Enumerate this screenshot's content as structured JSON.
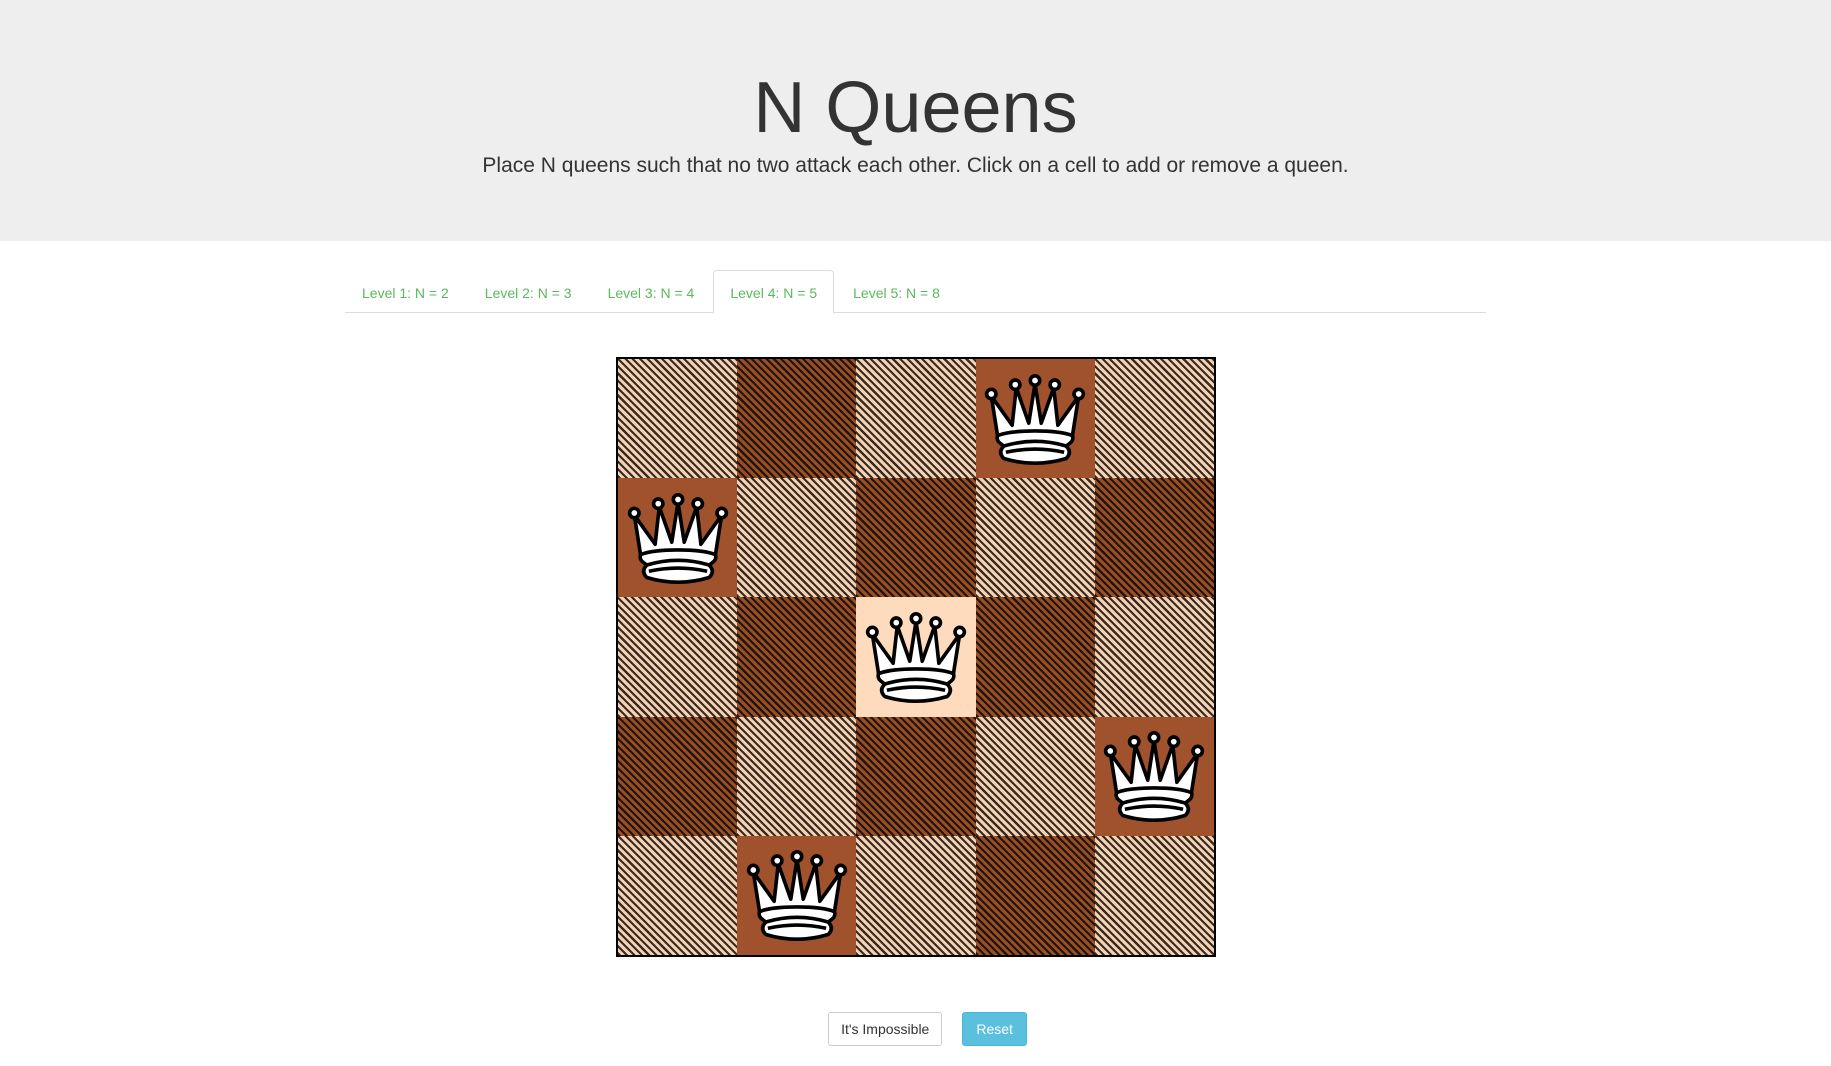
{
  "header": {
    "title": "N Queens",
    "subtitle": "Place N queens such that no two attack each other. Click on a cell to add or remove a queen."
  },
  "tabs": [
    {
      "label": "Level 1: N = 2",
      "active": false
    },
    {
      "label": "Level 2: N = 3",
      "active": false
    },
    {
      "label": "Level 3: N = 4",
      "active": false
    },
    {
      "label": "Level 4: N = 5",
      "active": true
    },
    {
      "label": "Level 5: N = 8",
      "active": false
    }
  ],
  "board": {
    "size": 5,
    "queens": [
      [
        0,
        3
      ],
      [
        1,
        0
      ],
      [
        2,
        2
      ],
      [
        3,
        4
      ],
      [
        4,
        1
      ]
    ],
    "piece_icon": "white-queen-icon",
    "colors": {
      "light": "#ffdbbd",
      "dark": "#a0522d",
      "hatch_light": "#f2d3b6",
      "hatch_dark": "#9a4e22"
    }
  },
  "buttons": {
    "impossible_label": "It's Impossible",
    "reset_label": "Reset"
  },
  "colors": {
    "tab_text": "#5cb85c",
    "reset_button": "#5bc0de",
    "header_bg": "#eeeeee"
  }
}
